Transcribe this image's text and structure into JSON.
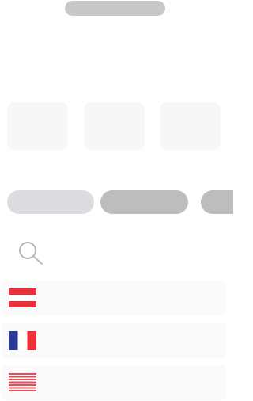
{
  "loading": {
    "top_pill": "",
    "cards": [
      "",
      "",
      ""
    ],
    "chips": [
      "",
      "",
      ""
    ]
  },
  "search": {
    "icon": "search-icon"
  },
  "list": {
    "items": [
      {
        "flag_icon": "flag-red-white-red-icon",
        "label": ""
      },
      {
        "flag_icon": "flag-france-icon",
        "label": ""
      },
      {
        "flag_icon": "flag-red-stripes-icon",
        "label": ""
      }
    ]
  },
  "colors": {
    "skeleton_dark": "#bdbdbd",
    "skeleton_light": "#dcdce0",
    "card_bg": "#f7f7f7",
    "row_bg": "#fafafa",
    "flag_red": "#e8313b",
    "flag_blue": "#2a3a97"
  }
}
